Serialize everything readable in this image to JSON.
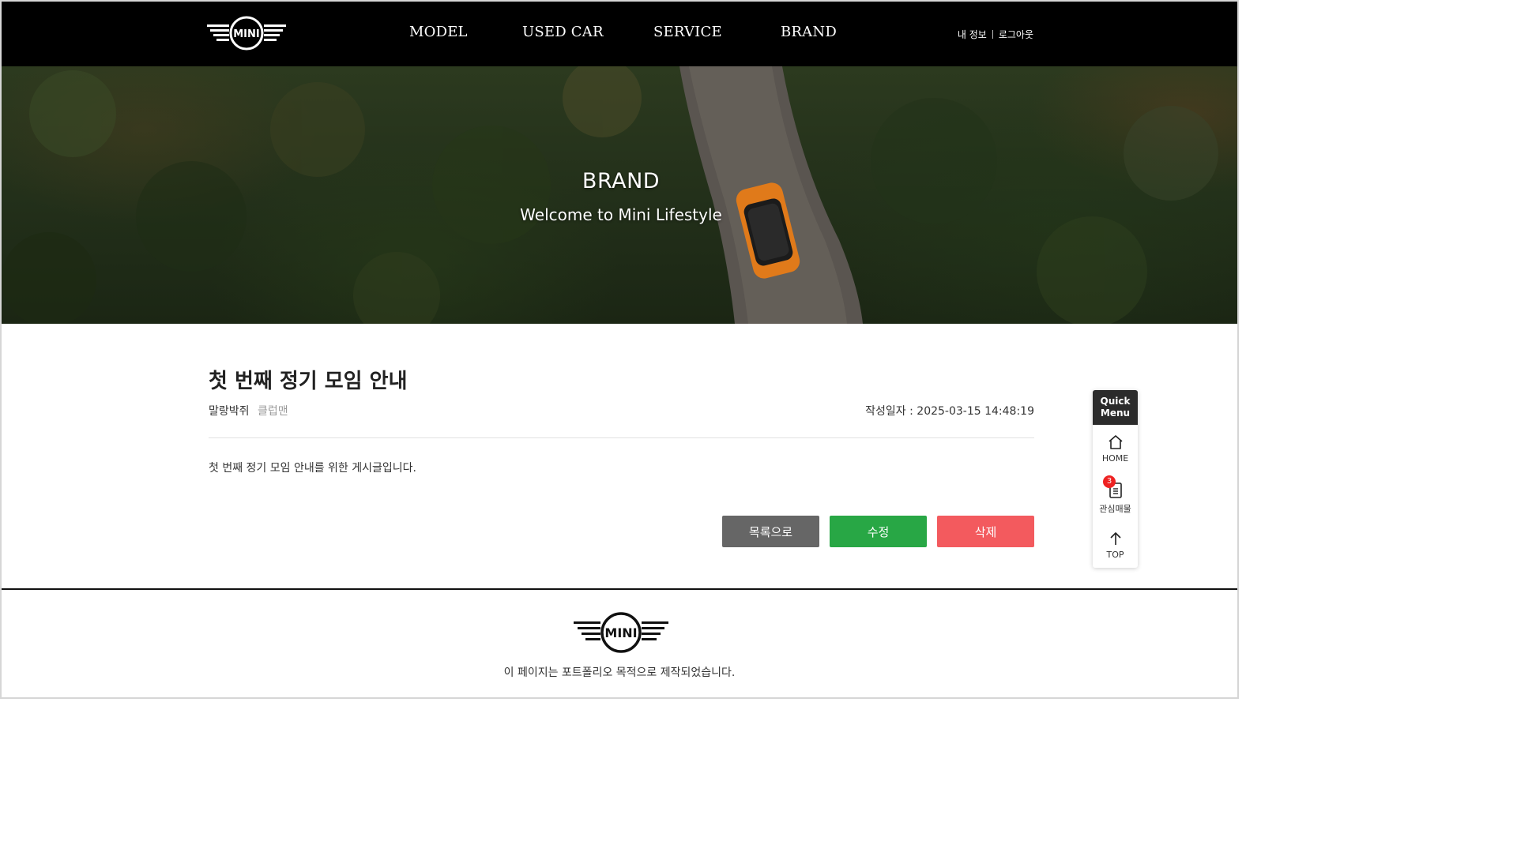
{
  "header": {
    "logo_text": "MINI",
    "nav": [
      {
        "label": "MODEL"
      },
      {
        "label": "USED CAR"
      },
      {
        "label": "SERVICE"
      },
      {
        "label": "BRAND"
      }
    ],
    "user_links": {
      "my_info": "내 정보",
      "logout": "로그아웃"
    }
  },
  "hero": {
    "title": "BRAND",
    "subtitle": "Welcome to Mini Lifestyle"
  },
  "post": {
    "title": "첫 번째 정기 모임 안내",
    "author": "말랑박쥐",
    "club": "클럽맨",
    "date_label": "작성일자 : ",
    "date": "2025-03-15 14:48:19",
    "body": "첫 번째 정기 모임 안내를 위한 게시글입니다.",
    "buttons": {
      "list": "목록으로",
      "edit": "수정",
      "delete": "삭제"
    }
  },
  "footer": {
    "logo_text": "MINI",
    "text": "이 페이지는 포트폴리오 목적으로 제작되었습니다."
  },
  "quick_menu": {
    "title_line1": "Quick",
    "title_line2": "Menu",
    "home": "HOME",
    "favorites": "관심매물",
    "favorites_count": "3",
    "top": "TOP"
  },
  "colors": {
    "header_bg": "#000000",
    "btn_list": "#666666",
    "btn_edit": "#28a745",
    "btn_delete": "#f35a5e",
    "badge": "#ee2222"
  },
  "icons": {
    "logo": "mini-wings-logo",
    "home": "home-icon",
    "favorites": "document-list-icon",
    "top": "arrow-up-icon"
  }
}
